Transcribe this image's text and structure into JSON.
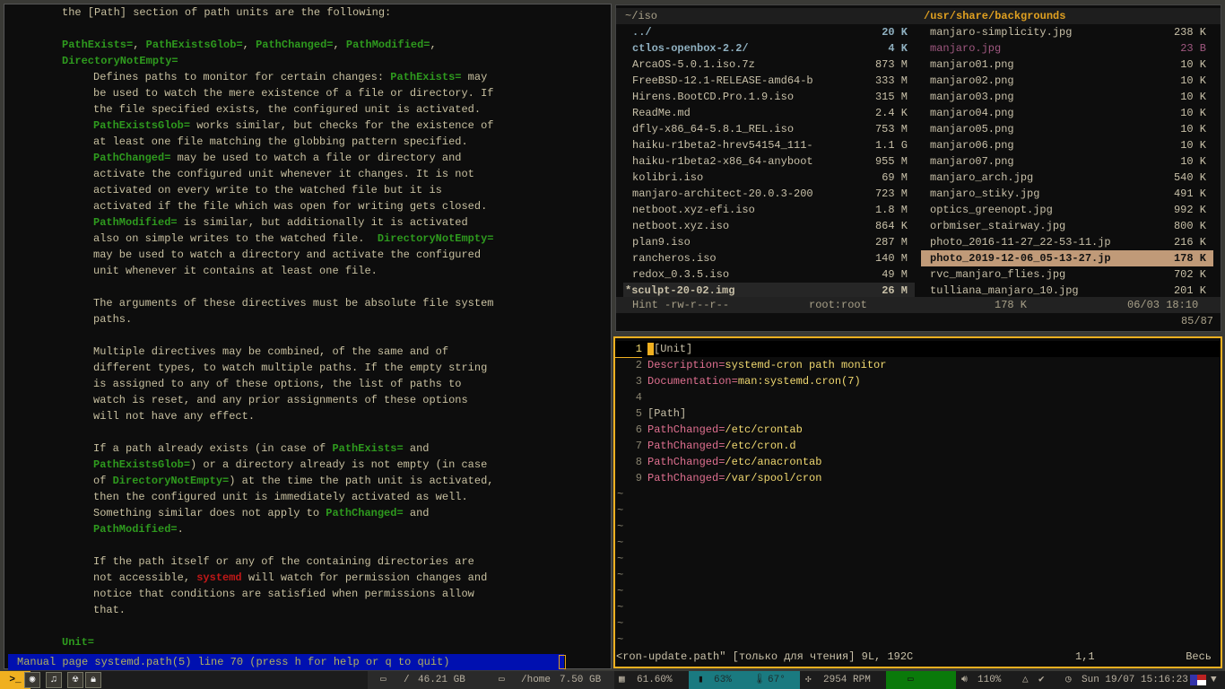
{
  "man": {
    "lines": [
      {
        "i": 1,
        "s": [
          [
            "the [Path] section of path units are the following:",
            "n"
          ]
        ]
      },
      {
        "i": 1,
        "s": []
      },
      {
        "i": 1,
        "s": [
          [
            "PathExists=",
            "g"
          ],
          [
            ", ",
            "n"
          ],
          [
            "PathExistsGlob=",
            "g"
          ],
          [
            ", ",
            "n"
          ],
          [
            "PathChanged=",
            "g"
          ],
          [
            ", ",
            "n"
          ],
          [
            "PathModified=",
            "g"
          ],
          [
            ",",
            "n"
          ]
        ]
      },
      {
        "i": 1,
        "s": [
          [
            "DirectoryNotEmpty=",
            "g"
          ]
        ]
      },
      {
        "i": 2,
        "s": [
          [
            "Defines paths to monitor for certain changes: ",
            "n"
          ],
          [
            "PathExists=",
            "g"
          ],
          [
            " may",
            "n"
          ]
        ]
      },
      {
        "i": 2,
        "s": [
          [
            "be used to watch the mere existence of a file or directory. If",
            "n"
          ]
        ]
      },
      {
        "i": 2,
        "s": [
          [
            "the file specified exists, the configured unit is activated.",
            "n"
          ]
        ]
      },
      {
        "i": 2,
        "s": [
          [
            "PathExistsGlob=",
            "g"
          ],
          [
            " works similar, but checks for the existence of",
            "n"
          ]
        ]
      },
      {
        "i": 2,
        "s": [
          [
            "at least one file matching the globbing pattern specified.",
            "n"
          ]
        ]
      },
      {
        "i": 2,
        "s": [
          [
            "PathChanged=",
            "g"
          ],
          [
            " may be used to watch a file or directory and",
            "n"
          ]
        ]
      },
      {
        "i": 2,
        "s": [
          [
            "activate the configured unit whenever it changes. It is not",
            "n"
          ]
        ]
      },
      {
        "i": 2,
        "s": [
          [
            "activated on every write to the watched file but it is",
            "n"
          ]
        ]
      },
      {
        "i": 2,
        "s": [
          [
            "activated if the file which was open for writing gets closed.",
            "n"
          ]
        ]
      },
      {
        "i": 2,
        "s": [
          [
            "PathModified=",
            "g"
          ],
          [
            " is similar, but additionally it is activated",
            "n"
          ]
        ]
      },
      {
        "i": 2,
        "s": [
          [
            "also on simple writes to the watched file.  ",
            "n"
          ],
          [
            "DirectoryNotEmpty=",
            "g"
          ]
        ]
      },
      {
        "i": 2,
        "s": [
          [
            "may be used to watch a directory and activate the configured",
            "n"
          ]
        ]
      },
      {
        "i": 2,
        "s": [
          [
            "unit whenever it contains at least one file.",
            "n"
          ]
        ]
      },
      {
        "i": 2,
        "s": []
      },
      {
        "i": 2,
        "s": [
          [
            "The arguments of these directives must be absolute file system",
            "n"
          ]
        ]
      },
      {
        "i": 2,
        "s": [
          [
            "paths.",
            "n"
          ]
        ]
      },
      {
        "i": 2,
        "s": []
      },
      {
        "i": 2,
        "s": [
          [
            "Multiple directives may be combined, of the same and of",
            "n"
          ]
        ]
      },
      {
        "i": 2,
        "s": [
          [
            "different types, to watch multiple paths. If the empty string",
            "n"
          ]
        ]
      },
      {
        "i": 2,
        "s": [
          [
            "is assigned to any of these options, the list of paths to",
            "n"
          ]
        ]
      },
      {
        "i": 2,
        "s": [
          [
            "watch is reset, and any prior assignments of these options",
            "n"
          ]
        ]
      },
      {
        "i": 2,
        "s": [
          [
            "will not have any effect.",
            "n"
          ]
        ]
      },
      {
        "i": 2,
        "s": []
      },
      {
        "i": 2,
        "s": [
          [
            "If a path already exists (in case of ",
            "n"
          ],
          [
            "PathExists=",
            "g"
          ],
          [
            " and",
            "n"
          ]
        ]
      },
      {
        "i": 2,
        "s": [
          [
            "PathExistsGlob=",
            "g"
          ],
          [
            ") or a directory already is not empty (in case",
            "n"
          ]
        ]
      },
      {
        "i": 2,
        "s": [
          [
            "of ",
            "n"
          ],
          [
            "DirectoryNotEmpty=",
            "g"
          ],
          [
            ") at the time the path unit is activated,",
            "n"
          ]
        ]
      },
      {
        "i": 2,
        "s": [
          [
            "then the configured unit is immediately activated as well.",
            "n"
          ]
        ]
      },
      {
        "i": 2,
        "s": [
          [
            "Something similar does not apply to ",
            "n"
          ],
          [
            "PathChanged=",
            "g"
          ],
          [
            " and",
            "n"
          ]
        ]
      },
      {
        "i": 2,
        "s": [
          [
            "PathModified=",
            "g"
          ],
          [
            ".",
            "n"
          ]
        ]
      },
      {
        "i": 2,
        "s": []
      },
      {
        "i": 2,
        "s": [
          [
            "If the path itself or any of the containing directories are",
            "n"
          ]
        ]
      },
      {
        "i": 2,
        "s": [
          [
            "not accessible, ",
            "n"
          ],
          [
            "systemd",
            "r"
          ],
          [
            " will watch for permission changes and",
            "n"
          ]
        ]
      },
      {
        "i": 2,
        "s": [
          [
            "notice that conditions are satisfied when permissions allow",
            "n"
          ]
        ]
      },
      {
        "i": 2,
        "s": [
          [
            "that.",
            "n"
          ]
        ]
      },
      {
        "i": 2,
        "s": []
      },
      {
        "i": 1,
        "s": [
          [
            "Unit=",
            "g"
          ]
        ]
      }
    ],
    "status": "Manual page systemd.path(5) line 70 (press h for help or q to quit)"
  },
  "ranger": {
    "left_path": "~/iso",
    "right_path": "/usr/share/backgrounds",
    "left_files": [
      {
        "name": "../",
        "size": "20 K",
        "t": "dir"
      },
      {
        "name": "ctlos-openbox-2.2/",
        "size": "4 K",
        "t": "dir"
      },
      {
        "name": "ArcaOS-5.0.1.iso.7z",
        "size": "873 M"
      },
      {
        "name": "FreeBSD-12.1-RELEASE-amd64-b",
        "size": "333 M"
      },
      {
        "name": "Hirens.BootCD.Pro.1.9.iso",
        "size": "315 M"
      },
      {
        "name": "ReadMe.md",
        "size": "2.4 K"
      },
      {
        "name": "dfly-x86_64-5.8.1_REL.iso",
        "size": "753 M"
      },
      {
        "name": "haiku-r1beta2-hrev54154_111-",
        "size": "1.1 G"
      },
      {
        "name": "haiku-r1beta2-x86_64-anyboot",
        "size": "955 M"
      },
      {
        "name": "kolibri.iso",
        "size": "69 M"
      },
      {
        "name": "manjaro-architect-20.0.3-200",
        "size": "723 M"
      },
      {
        "name": "netboot.xyz-efi.iso",
        "size": "1.8 M"
      },
      {
        "name": "netboot.xyz.iso",
        "size": "864 K"
      },
      {
        "name": "plan9.iso",
        "size": "287 M"
      },
      {
        "name": "rancheros.iso",
        "size": "140 M"
      },
      {
        "name": "redox_0.3.5.iso",
        "size": "49 M"
      },
      {
        "name": "*sculpt-20-02.img",
        "size": "26 M",
        "t": "cur"
      }
    ],
    "right_files": [
      {
        "name": "manjaro-simplicity.jpg",
        "size": "238 K"
      },
      {
        "name": "manjaro.jpg",
        "size": "23 B",
        "t": "purple"
      },
      {
        "name": "manjaro01.png",
        "size": "10 K"
      },
      {
        "name": "manjaro02.png",
        "size": "10 K"
      },
      {
        "name": "manjaro03.png",
        "size": "10 K"
      },
      {
        "name": "manjaro04.png",
        "size": "10 K"
      },
      {
        "name": "manjaro05.png",
        "size": "10 K"
      },
      {
        "name": "manjaro06.png",
        "size": "10 K"
      },
      {
        "name": "manjaro07.png",
        "size": "10 K"
      },
      {
        "name": "manjaro_arch.jpg",
        "size": "540 K"
      },
      {
        "name": "manjaro_stiky.jpg",
        "size": "491 K"
      },
      {
        "name": "optics_greenopt.jpg",
        "size": "992 K"
      },
      {
        "name": "orbmiser_stairway.jpg",
        "size": "800 K"
      },
      {
        "name": "photo_2016-11-27_22-53-11.jp",
        "size": "216 K"
      },
      {
        "name": "photo_2019-12-06_05-13-27.jp",
        "size": "178 K",
        "t": "sel"
      },
      {
        "name": "rvc_manjaro_flies.jpg",
        "size": "702 K"
      },
      {
        "name": "tulliana_manjaro_10.jpg",
        "size": "201 K"
      }
    ],
    "status": {
      "perms": "Hint -rw-r--r--",
      "owner": "root:root",
      "size": "178 K",
      "date": "06/03 18:10",
      "position": "85/87"
    }
  },
  "vim": {
    "lines": [
      {
        "n": "1",
        "k": "[Unit]",
        "v": "",
        "t": "sec"
      },
      {
        "n": "2",
        "k": "Description=",
        "v": "systemd-cron path monitor"
      },
      {
        "n": "3",
        "k": "Documentation=",
        "v": "man:systemd.cron(7)"
      },
      {
        "n": "4",
        "k": "",
        "v": ""
      },
      {
        "n": "5",
        "k": "[Path]",
        "v": "",
        "t": "sec"
      },
      {
        "n": "6",
        "k": "PathChanged=",
        "v": "/etc/crontab"
      },
      {
        "n": "7",
        "k": "PathChanged=",
        "v": "/etc/cron.d"
      },
      {
        "n": "8",
        "k": "PathChanged=",
        "v": "/etc/anacrontab"
      },
      {
        "n": "9",
        "k": "PathChanged=",
        "v": "/var/spool/cron"
      }
    ],
    "tilde": "~",
    "status_file": "<ron-update.path\" [только для чтения] 9L, 192C",
    "status_pos": "1,1",
    "status_scroll": "Весь"
  },
  "bar": {
    "root_label": "/",
    "root_size": "46.21 GB",
    "home_label": "/home",
    "home_size": "7.50 GB",
    "mem": "61.60%",
    "cpu": "63%",
    "temp": "67°",
    "fan": "2954 RPM",
    "volume": "110%",
    "clock": "Sun 19/07 15:16:23",
    "terminal_glyph": ">_",
    "teal": "#1a7a80",
    "green": "#0a7a0a"
  }
}
